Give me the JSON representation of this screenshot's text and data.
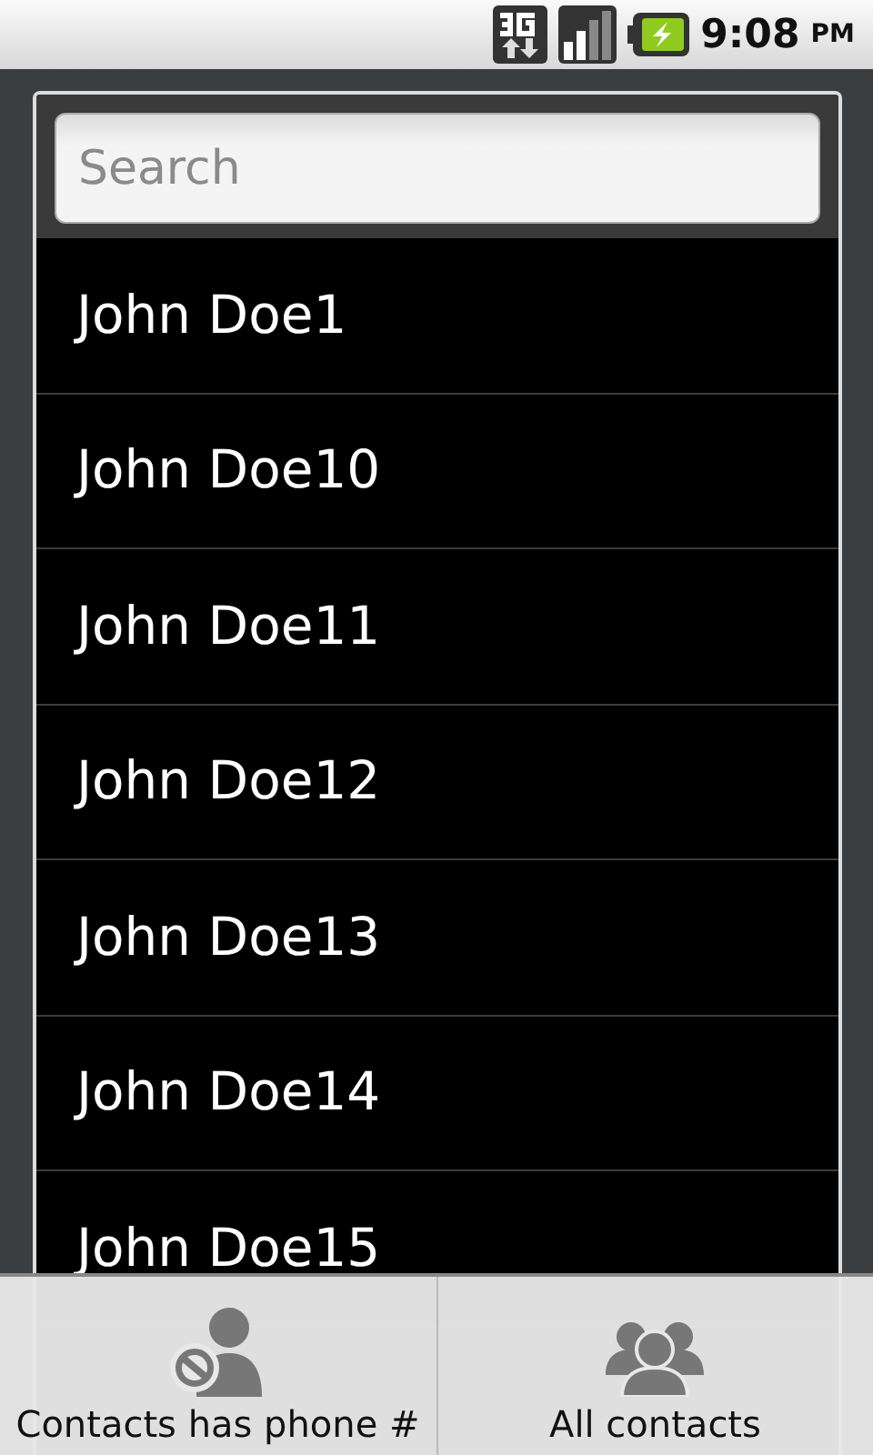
{
  "status_bar": {
    "time": "9:08",
    "ampm": "PM"
  },
  "search": {
    "placeholder": "Search"
  },
  "contacts": [
    {
      "name": "John Doe1"
    },
    {
      "name": "John Doe10"
    },
    {
      "name": "John Doe11"
    },
    {
      "name": "John Doe12"
    },
    {
      "name": "John Doe13"
    },
    {
      "name": "John Doe14"
    },
    {
      "name": "John Doe15"
    }
  ],
  "menu": [
    {
      "label": "Contacts has phone #",
      "kind": "phone-filter"
    },
    {
      "label": "All contacts",
      "kind": "all"
    }
  ]
}
